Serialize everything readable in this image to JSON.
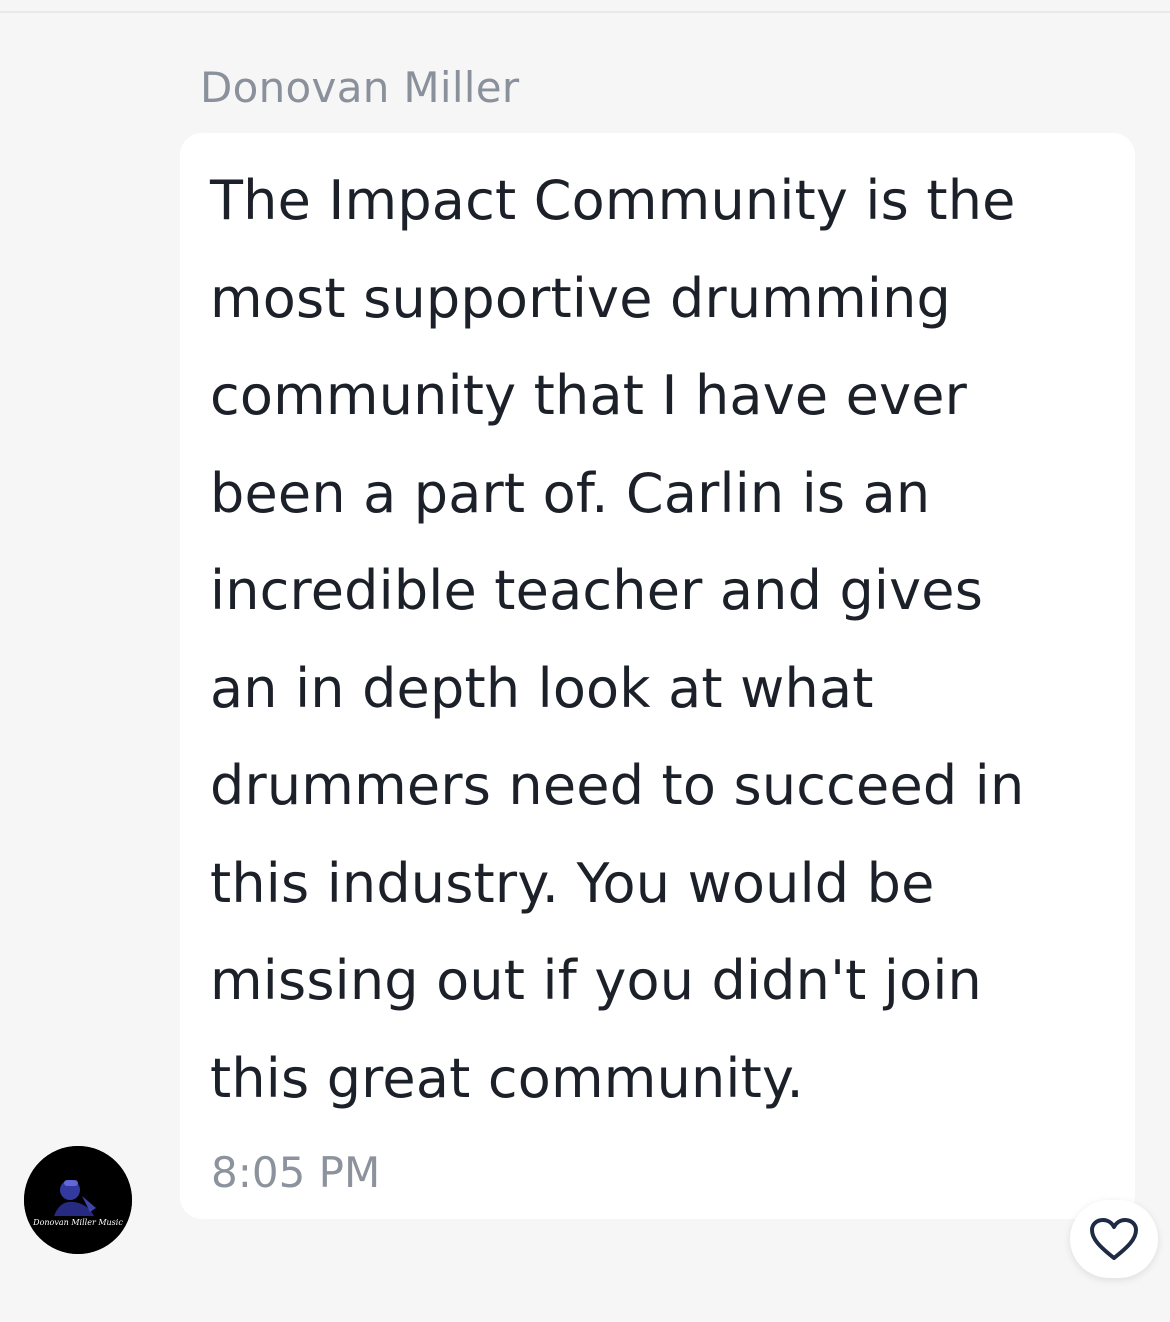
{
  "message": {
    "sender_name": "Donovan Miller",
    "text": "The Impact Community is the\nmost supportive drumming\ncommunity that I have ever\nbeen a part of. Carlin is an\nincredible teacher and gives\nan in depth look at what\ndrummers need to succeed in\nthis industry. You would be\nmissing out if you didn't join\nthis great community.",
    "timestamp": "8:05 PM",
    "avatar_label": "Donovan Miller Music"
  },
  "icons": {
    "like": "heart-icon"
  },
  "colors": {
    "background": "#f6f6f7",
    "bubble": "#ffffff",
    "text": "#1c2029",
    "muted": "#8a919b",
    "heart": "#1f2a44"
  }
}
